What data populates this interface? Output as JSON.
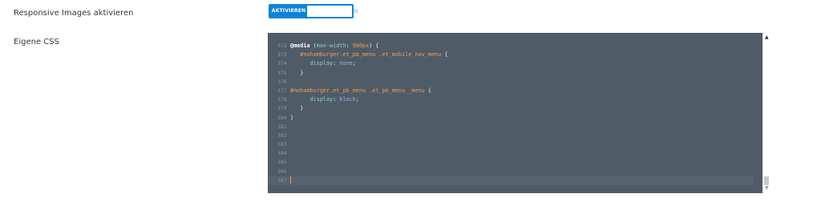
{
  "settings": {
    "responsive_label": "Responsive Images aktivieren",
    "custom_css_label": "Eigene CSS",
    "toggle_on_label": "AKTIVIEREN",
    "toggle_off_label": "N"
  },
  "editor": {
    "lines": [
      {
        "num": "372",
        "tokens": [
          {
            "t": "@media",
            "c": "kw"
          },
          {
            "t": " (",
            "c": "pun"
          },
          {
            "t": "max-width",
            "c": "prop"
          },
          {
            "t": ": ",
            "c": "pun"
          },
          {
            "t": "980px",
            "c": "num"
          },
          {
            "t": ") {",
            "c": "pun"
          }
        ]
      },
      {
        "num": "373",
        "tokens": [
          {
            "t": "   ",
            "c": "pun"
          },
          {
            "t": "#nohamburger.et_pb_menu .et_mobile_nav_menu",
            "c": "sel"
          },
          {
            "t": " {",
            "c": "pun"
          }
        ]
      },
      {
        "num": "374",
        "tokens": [
          {
            "t": "      ",
            "c": "pun"
          },
          {
            "t": "display",
            "c": "prop"
          },
          {
            "t": ": ",
            "c": "pun"
          },
          {
            "t": "none",
            "c": "val"
          },
          {
            "t": ";",
            "c": "pun"
          }
        ]
      },
      {
        "num": "375",
        "tokens": [
          {
            "t": "   }",
            "c": "pun"
          }
        ]
      },
      {
        "num": "376",
        "tokens": []
      },
      {
        "num": "377",
        "tokens": [
          {
            "t": "#nohamburger.et_pb_menu .et_pb_menu__menu",
            "c": "sel"
          },
          {
            "t": " {",
            "c": "pun"
          }
        ]
      },
      {
        "num": "378",
        "tokens": [
          {
            "t": "      ",
            "c": "pun"
          },
          {
            "t": "display",
            "c": "prop"
          },
          {
            "t": ": ",
            "c": "pun"
          },
          {
            "t": "block",
            "c": "val"
          },
          {
            "t": ";",
            "c": "pun"
          }
        ]
      },
      {
        "num": "379",
        "tokens": [
          {
            "t": "   }",
            "c": "pun"
          }
        ]
      },
      {
        "num": "380",
        "tokens": [
          {
            "t": "}",
            "c": "pun"
          }
        ]
      },
      {
        "num": "381",
        "tokens": []
      },
      {
        "num": "382",
        "tokens": []
      },
      {
        "num": "383",
        "tokens": []
      },
      {
        "num": "384",
        "tokens": []
      },
      {
        "num": "385",
        "tokens": []
      },
      {
        "num": "386",
        "tokens": []
      },
      {
        "num": "387",
        "tokens": [],
        "active": true
      }
    ]
  },
  "colors": {
    "accent": "#0c83d6",
    "editor_bg": "#4f5b66"
  }
}
